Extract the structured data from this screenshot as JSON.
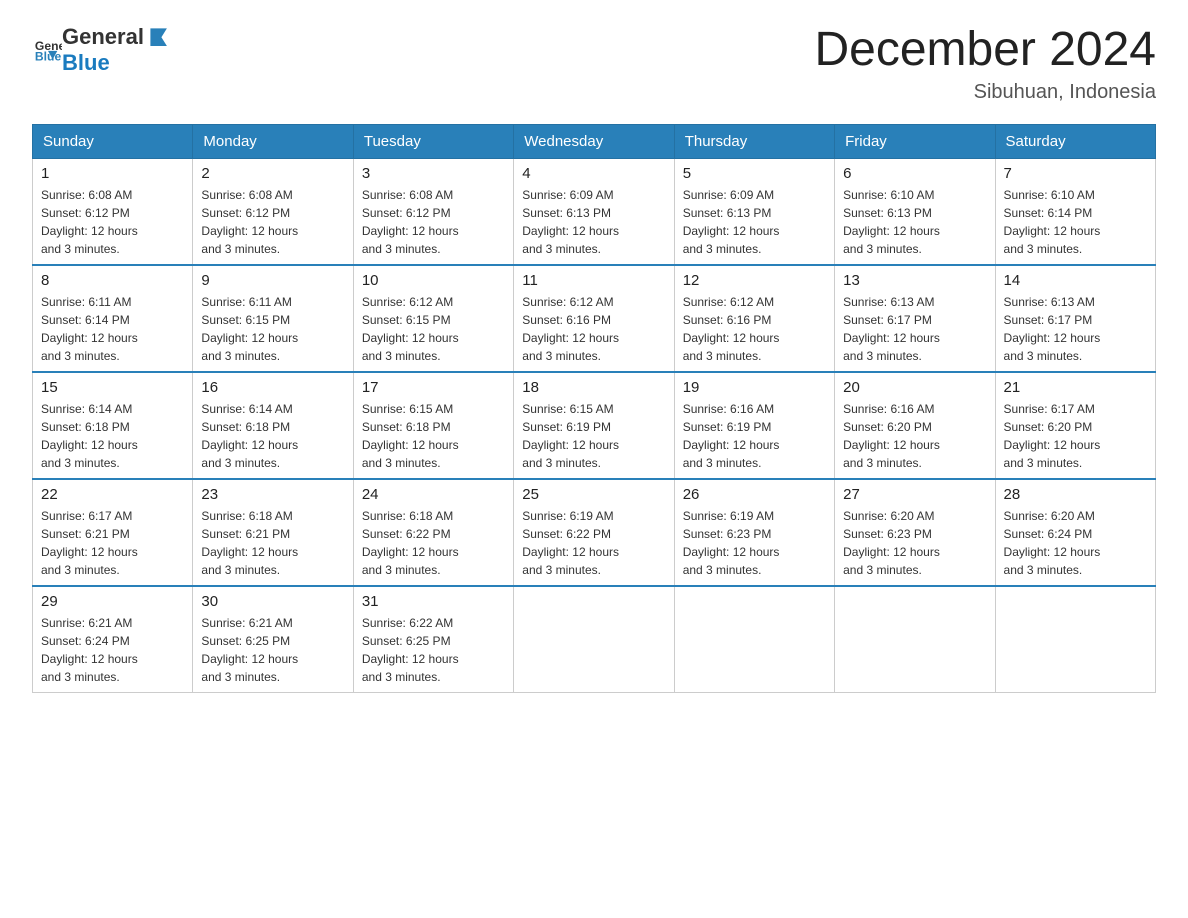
{
  "logo": {
    "text_general": "General",
    "text_blue": "Blue"
  },
  "title": "December 2024",
  "location": "Sibuhuan, Indonesia",
  "days_of_week": [
    "Sunday",
    "Monday",
    "Tuesday",
    "Wednesday",
    "Thursday",
    "Friday",
    "Saturday"
  ],
  "weeks": [
    [
      {
        "day": "1",
        "sunrise": "6:08 AM",
        "sunset": "6:12 PM",
        "daylight": "12 hours and 3 minutes."
      },
      {
        "day": "2",
        "sunrise": "6:08 AM",
        "sunset": "6:12 PM",
        "daylight": "12 hours and 3 minutes."
      },
      {
        "day": "3",
        "sunrise": "6:08 AM",
        "sunset": "6:12 PM",
        "daylight": "12 hours and 3 minutes."
      },
      {
        "day": "4",
        "sunrise": "6:09 AM",
        "sunset": "6:13 PM",
        "daylight": "12 hours and 3 minutes."
      },
      {
        "day": "5",
        "sunrise": "6:09 AM",
        "sunset": "6:13 PM",
        "daylight": "12 hours and 3 minutes."
      },
      {
        "day": "6",
        "sunrise": "6:10 AM",
        "sunset": "6:13 PM",
        "daylight": "12 hours and 3 minutes."
      },
      {
        "day": "7",
        "sunrise": "6:10 AM",
        "sunset": "6:14 PM",
        "daylight": "12 hours and 3 minutes."
      }
    ],
    [
      {
        "day": "8",
        "sunrise": "6:11 AM",
        "sunset": "6:14 PM",
        "daylight": "12 hours and 3 minutes."
      },
      {
        "day": "9",
        "sunrise": "6:11 AM",
        "sunset": "6:15 PM",
        "daylight": "12 hours and 3 minutes."
      },
      {
        "day": "10",
        "sunrise": "6:12 AM",
        "sunset": "6:15 PM",
        "daylight": "12 hours and 3 minutes."
      },
      {
        "day": "11",
        "sunrise": "6:12 AM",
        "sunset": "6:16 PM",
        "daylight": "12 hours and 3 minutes."
      },
      {
        "day": "12",
        "sunrise": "6:12 AM",
        "sunset": "6:16 PM",
        "daylight": "12 hours and 3 minutes."
      },
      {
        "day": "13",
        "sunrise": "6:13 AM",
        "sunset": "6:17 PM",
        "daylight": "12 hours and 3 minutes."
      },
      {
        "day": "14",
        "sunrise": "6:13 AM",
        "sunset": "6:17 PM",
        "daylight": "12 hours and 3 minutes."
      }
    ],
    [
      {
        "day": "15",
        "sunrise": "6:14 AM",
        "sunset": "6:18 PM",
        "daylight": "12 hours and 3 minutes."
      },
      {
        "day": "16",
        "sunrise": "6:14 AM",
        "sunset": "6:18 PM",
        "daylight": "12 hours and 3 minutes."
      },
      {
        "day": "17",
        "sunrise": "6:15 AM",
        "sunset": "6:18 PM",
        "daylight": "12 hours and 3 minutes."
      },
      {
        "day": "18",
        "sunrise": "6:15 AM",
        "sunset": "6:19 PM",
        "daylight": "12 hours and 3 minutes."
      },
      {
        "day": "19",
        "sunrise": "6:16 AM",
        "sunset": "6:19 PM",
        "daylight": "12 hours and 3 minutes."
      },
      {
        "day": "20",
        "sunrise": "6:16 AM",
        "sunset": "6:20 PM",
        "daylight": "12 hours and 3 minutes."
      },
      {
        "day": "21",
        "sunrise": "6:17 AM",
        "sunset": "6:20 PM",
        "daylight": "12 hours and 3 minutes."
      }
    ],
    [
      {
        "day": "22",
        "sunrise": "6:17 AM",
        "sunset": "6:21 PM",
        "daylight": "12 hours and 3 minutes."
      },
      {
        "day": "23",
        "sunrise": "6:18 AM",
        "sunset": "6:21 PM",
        "daylight": "12 hours and 3 minutes."
      },
      {
        "day": "24",
        "sunrise": "6:18 AM",
        "sunset": "6:22 PM",
        "daylight": "12 hours and 3 minutes."
      },
      {
        "day": "25",
        "sunrise": "6:19 AM",
        "sunset": "6:22 PM",
        "daylight": "12 hours and 3 minutes."
      },
      {
        "day": "26",
        "sunrise": "6:19 AM",
        "sunset": "6:23 PM",
        "daylight": "12 hours and 3 minutes."
      },
      {
        "day": "27",
        "sunrise": "6:20 AM",
        "sunset": "6:23 PM",
        "daylight": "12 hours and 3 minutes."
      },
      {
        "day": "28",
        "sunrise": "6:20 AM",
        "sunset": "6:24 PM",
        "daylight": "12 hours and 3 minutes."
      }
    ],
    [
      {
        "day": "29",
        "sunrise": "6:21 AM",
        "sunset": "6:24 PM",
        "daylight": "12 hours and 3 minutes."
      },
      {
        "day": "30",
        "sunrise": "6:21 AM",
        "sunset": "6:25 PM",
        "daylight": "12 hours and 3 minutes."
      },
      {
        "day": "31",
        "sunrise": "6:22 AM",
        "sunset": "6:25 PM",
        "daylight": "12 hours and 3 minutes."
      },
      null,
      null,
      null,
      null
    ]
  ]
}
